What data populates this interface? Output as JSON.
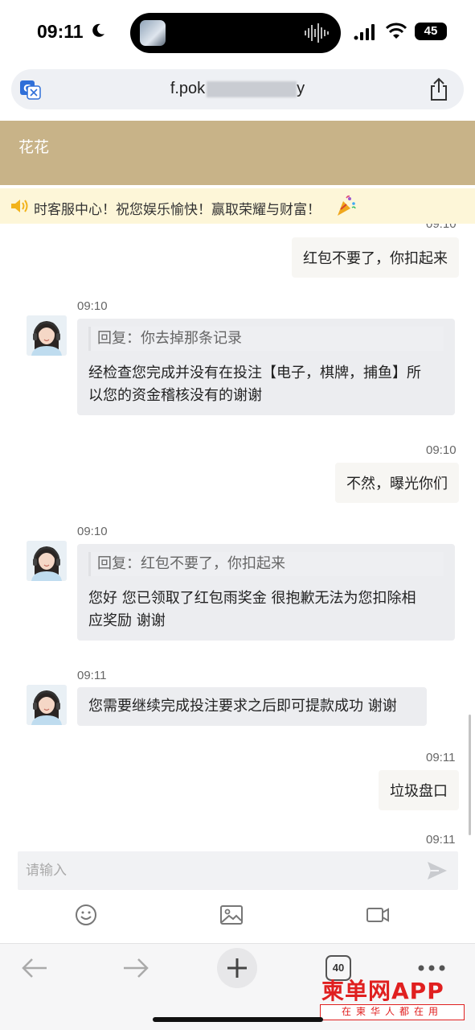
{
  "status_bar": {
    "time": "09:11",
    "battery": "45"
  },
  "browser": {
    "url_visible": "f.pok",
    "url_suffix": "y",
    "tab_count": "40"
  },
  "chat": {
    "title": "花花",
    "notice": "时客服中心！祝您娱乐愉快！赢取荣耀与财富！",
    "messages": [
      {
        "side": "out",
        "time": "09:10",
        "text": "红包不要了，你扣起来"
      },
      {
        "side": "in",
        "time": "09:10",
        "quote": "回复：你去掉那条记录",
        "line1": "经检查您完成并没有在投注【电子，棋牌，捕鱼】所",
        "line2": "以您的资金稽核没有的谢谢"
      },
      {
        "side": "out",
        "time": "09:10",
        "text": "不然，曝光你们"
      },
      {
        "side": "in",
        "time": "09:10",
        "quote": "回复：红包不要了，你扣起来",
        "line1": "您好 您已领取了红包雨奖金 很抱歉无法为您扣除相",
        "line2": "应奖励 谢谢"
      },
      {
        "side": "in",
        "time": "09:11",
        "text": "您需要继续完成投注要求之后即可提款成功 谢谢"
      },
      {
        "side": "out",
        "time": "09:11",
        "text": "垃圾盘口"
      },
      {
        "side": "out",
        "time": "09:11"
      }
    ],
    "input_placeholder": "请输入"
  },
  "watermark": {
    "title": "柬单网APP",
    "subtitle": "在柬华人都在用"
  },
  "colors": {
    "header": "#c8b388",
    "notice_bg": "#fdf6d8",
    "watermark": "#e02020"
  }
}
